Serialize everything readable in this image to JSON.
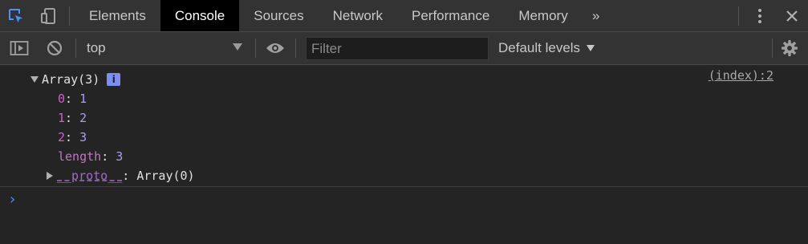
{
  "tabs": [
    {
      "label": "Elements"
    },
    {
      "label": "Console"
    },
    {
      "label": "Sources"
    },
    {
      "label": "Network"
    },
    {
      "label": "Performance"
    },
    {
      "label": "Memory"
    }
  ],
  "tabs_more": "»",
  "toolbar": {
    "context": "top",
    "filter_placeholder": "Filter",
    "levels": "Default levels"
  },
  "console": {
    "array_summary": "Array(3)",
    "info_badge": "i",
    "source": "(index):2",
    "items": [
      {
        "key": "0",
        "value": "1"
      },
      {
        "key": "1",
        "value": "2"
      },
      {
        "key": "2",
        "value": "3"
      }
    ],
    "length_key": "length",
    "length_value": "3",
    "proto_key": "__proto__",
    "proto_value": "Array(0)",
    "colon": ": "
  },
  "prompt_symbol": "›",
  "colors": {
    "accent_blue": "#4c8fff",
    "key_magenta": "#d35cd3",
    "number_purple": "#a89ef2"
  },
  "icons": [
    "inspect-element-icon",
    "device-toolbar-icon",
    "more-vertical-icon",
    "close-icon",
    "sidebar-toggle-icon",
    "clear-console-icon",
    "eye-icon",
    "gear-icon"
  ]
}
